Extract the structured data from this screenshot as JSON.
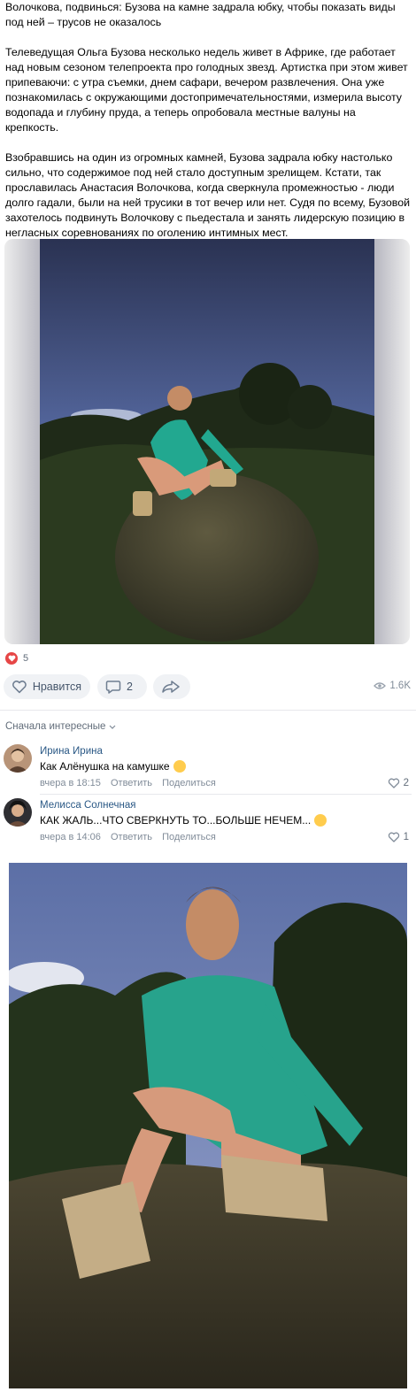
{
  "post": {
    "paragraphs": [
      "Волочкова, подвинься: Бузова на камне задрала юбку, чтобы показать виды под ней – трусов не оказалось",
      "Телеведущая Ольга Бузова несколько недель живет в Африке, где работает над новым сезоном телепроекта про голодных звезд. Артистка при этом живет припеваючи: с утра съемки, днем сафари, вечером развлечения. Она уже познакомилась с окружающими достопримечательностями, измерила высоту водопада и глубину пруда, а теперь опробовала местные валуны на крепкость.",
      "Взобравшись на один из огромных камней, Бузова задрала юбку настолько сильно, что содержимое под ней стало доступным зрелищем. Кстати, так прославилась Анастасия Волочкова, когда сверкнула промежностью - люди долго гадали, были на ней трусики в тот вечер или нет. Судя по всему, Бузовой захотелось подвинуть Волочкову с пьедестала и занять лидерскую позицию в негласных соревнованиях по оголению интимных мест."
    ]
  },
  "reactions": {
    "icon": "heart-icon",
    "count": "5"
  },
  "actions": {
    "like_label": "Нравится",
    "comments_count": "2",
    "views": "1.6K"
  },
  "comments_sort": {
    "label": "Сначала интересные"
  },
  "comments": [
    {
      "author": "Ирина Ирина",
      "text": "Как Алёнушка на камушке",
      "time": "вчера в 18:15",
      "reply": "Ответить",
      "share": "Поделиться",
      "likes": "2"
    },
    {
      "author": "Мелисса Солнечная",
      "text": "КАК ЖАЛЬ...ЧТО СВЕРКНУТЬ ТО...БОЛЬШЕ НЕЧЕМ...",
      "time": "вчера в 14:06",
      "reply": "Ответить",
      "share": "Поделиться",
      "likes": "1"
    }
  ],
  "colors": {
    "link": "#2a5885",
    "secondary": "#818c99",
    "button_bg": "#f0f2f5",
    "like_red": "#e64646"
  }
}
